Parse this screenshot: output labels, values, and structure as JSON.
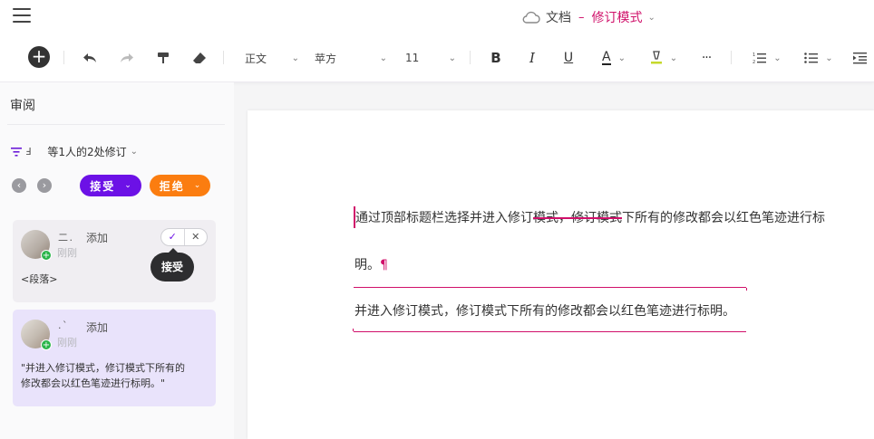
{
  "header": {
    "doc_label": "文档",
    "separator": "–",
    "mode_label": "修订模式",
    "mode_caret": "⌄"
  },
  "toolbar": {
    "style_value": "正文",
    "font_value": "苹方",
    "size_value": "11",
    "bold": "B",
    "italic": "I",
    "underline": "U",
    "font_color_letter": "A",
    "more": "···",
    "chevron": "⌄"
  },
  "colors": {
    "accent_purple": "#6c11e6",
    "accent_orange": "#fb7d10",
    "revision_pink": "#d0106a"
  },
  "review": {
    "title": "审阅",
    "filter_icon": "filter-icon",
    "filter_prefix": "Ⅎ",
    "filter_text": "等1人的2处修订",
    "filter_caret": "⌄",
    "prev": "‹",
    "next": "›",
    "accept_label": "接受",
    "reject_label": "拒绝",
    "dropdown_caret": "⌄",
    "tooltip": "接受",
    "cards": [
      {
        "user": "二 .",
        "action": "添加",
        "time": "刚刚",
        "content": "<段落>",
        "confirm_icon": "✓",
        "cancel_icon": "✕"
      },
      {
        "user": ".  `",
        "action": "添加",
        "time": "刚刚",
        "content_line1": "\"并进入修订模式，修订模式下所有的",
        "content_line2": "修改都会以红色笔迹进行标明。\""
      }
    ]
  },
  "document": {
    "line1_before": "通过顶部标题栏选择并进入修订",
    "line1_deleted": "模式，修订模式",
    "line1_after": "下所有的修改都会以红色笔迹进行标",
    "line2": "明。",
    "pilcrow": "¶",
    "inserted": "并进入修订模式，修订模式下所有的修改都会以红色笔迹进行标明。"
  }
}
